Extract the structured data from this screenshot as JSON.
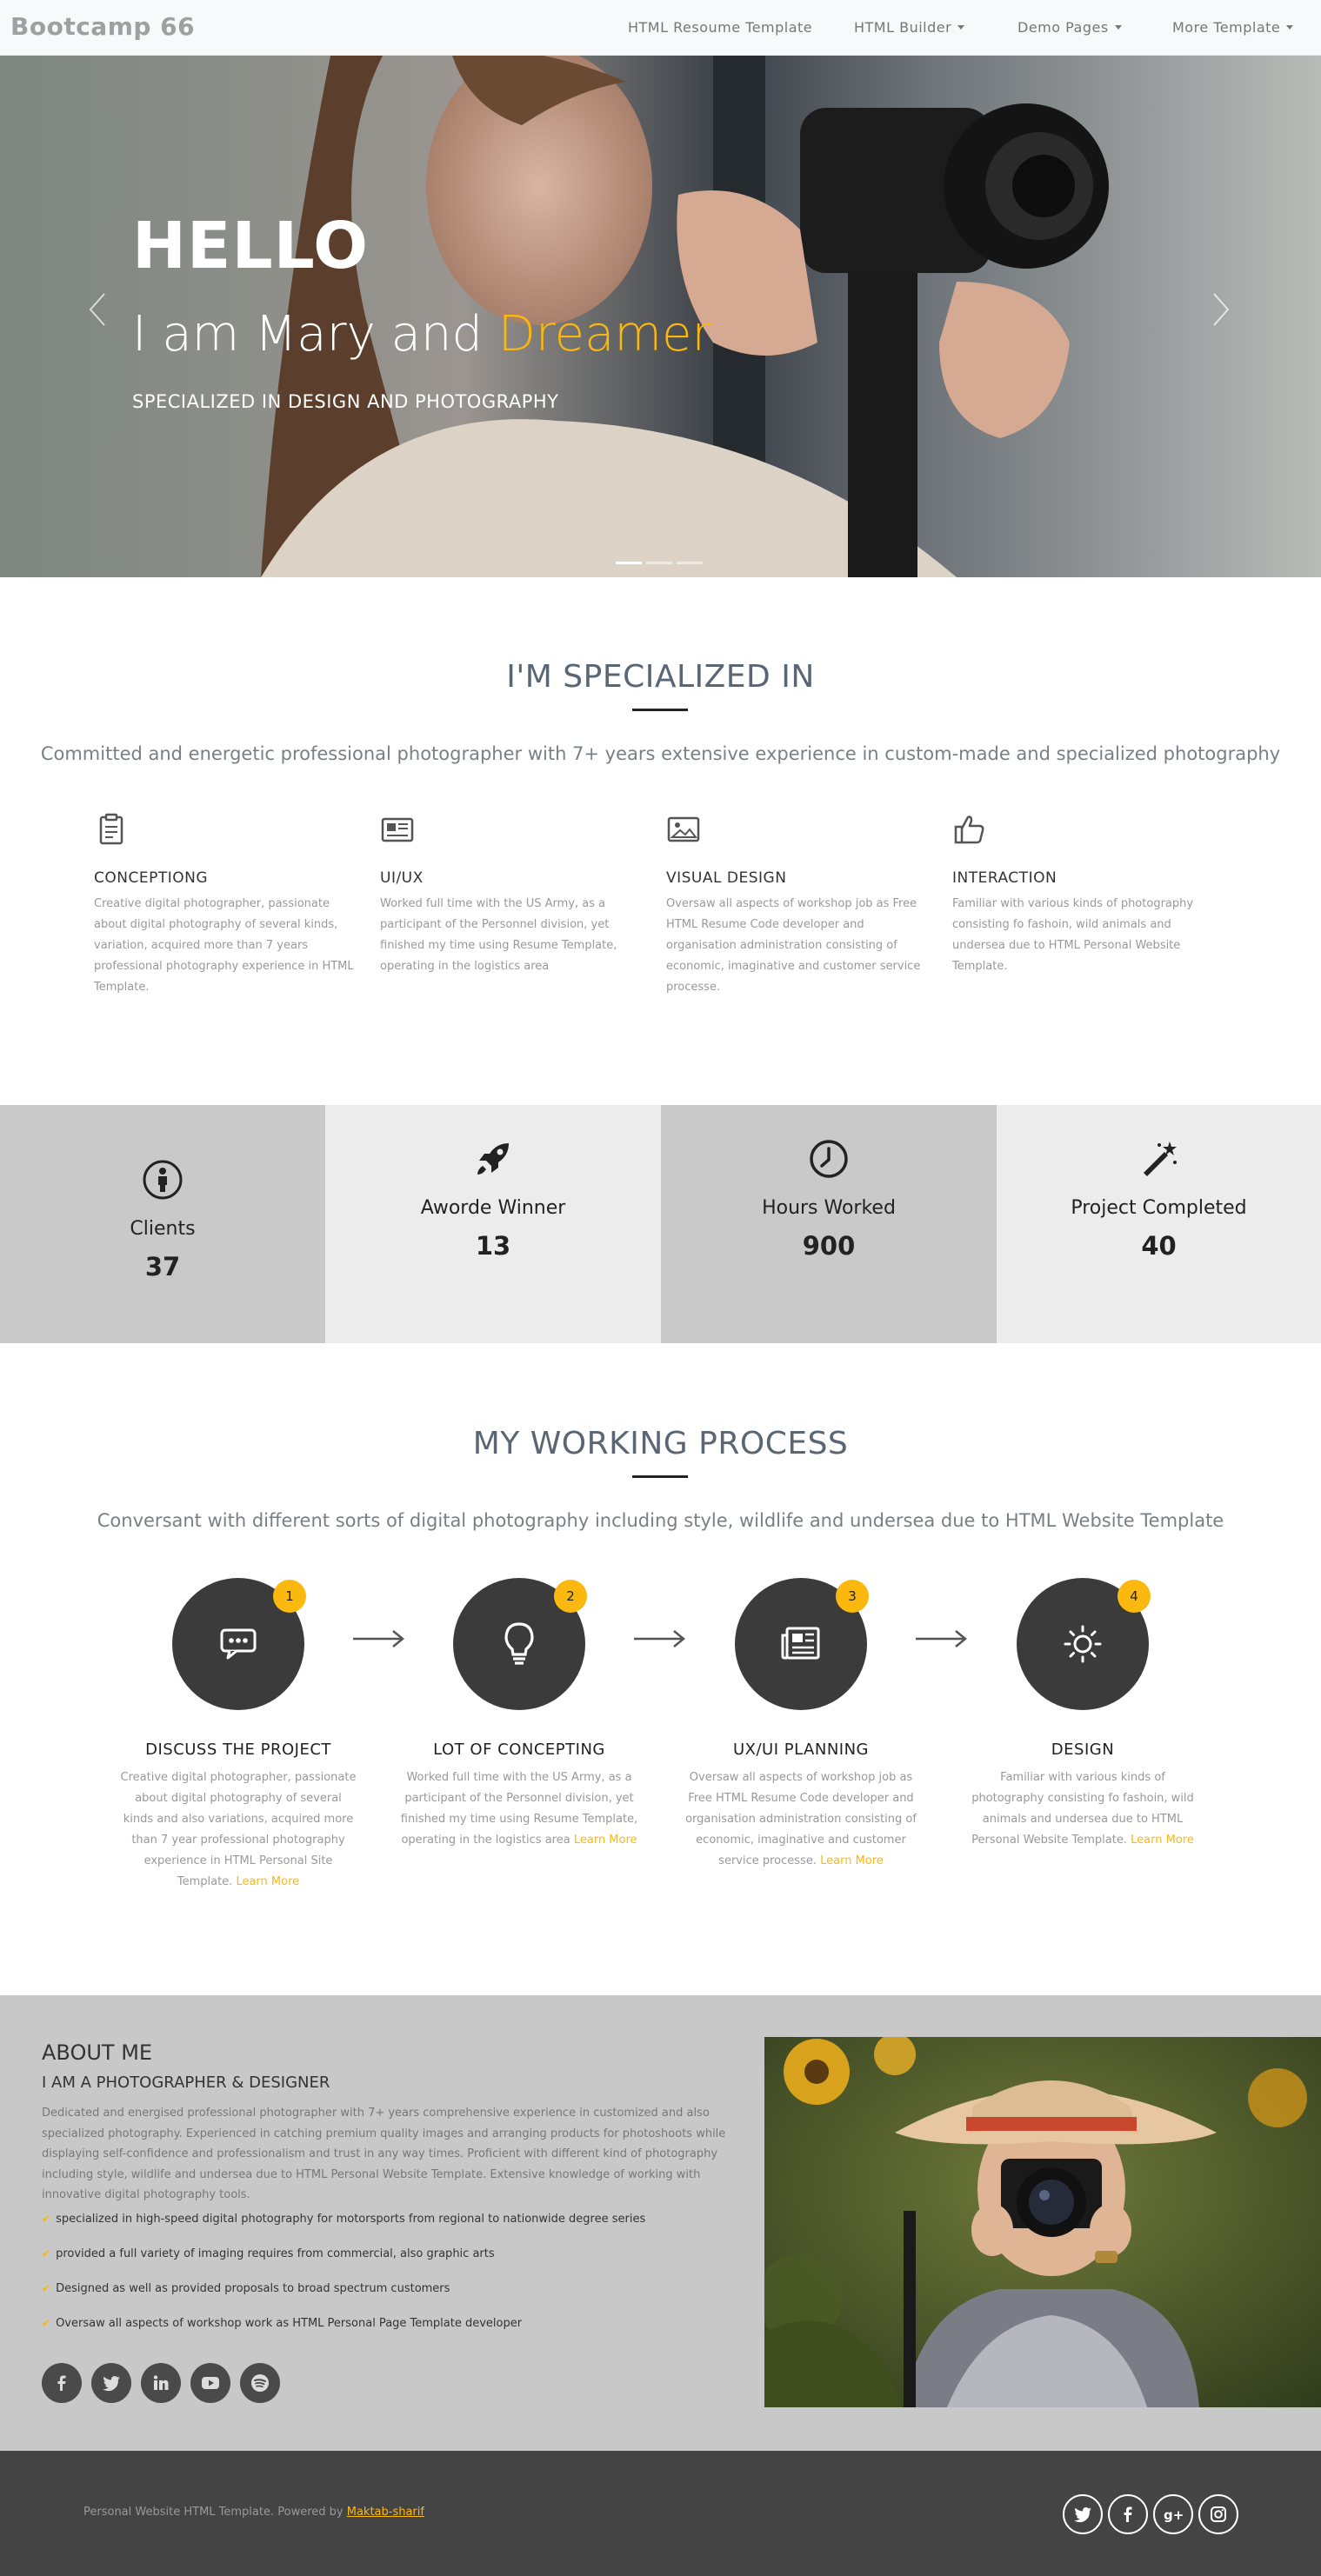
{
  "nav": {
    "brand": "Bootcamp 66",
    "items": [
      {
        "label": "HTML Resoume Template",
        "dropdown": false
      },
      {
        "label": "HTML Builder",
        "dropdown": true
      },
      {
        "label": "Demo Pages",
        "dropdown": true
      },
      {
        "label": "More Template",
        "dropdown": true
      }
    ]
  },
  "hero": {
    "hello": "HELLO",
    "line_prefix": "I am Mary and",
    "line_accent": "Dreamer",
    "subtitle": "SPECIALIZED IN DESIGN AND PHOTOGRAPHY",
    "prev_icon": "chevron-left-icon",
    "next_icon": "chevron-right-icon",
    "slides": 3,
    "active_slide": 1
  },
  "specialized": {
    "title": "I'M SPECIALIZED IN",
    "lead": "Committed and energetic professional photographer with 7+ years extensive experience in custom-made and specialized photography",
    "items": [
      {
        "icon": "clipboard-icon",
        "title": "CONCEPTIONG",
        "text": "Creative digital photographer, passionate about digital photography of several kinds, variation, acquired more than 7 years professional photography experience in HTML Template."
      },
      {
        "icon": "newspaper-icon",
        "title": "UI/UX",
        "text": "Worked full time with the US Army, as a participant of the Personnel division, yet finished my time using Resume Template, operating in the logistics area"
      },
      {
        "icon": "image-icon",
        "title": "VISUAL DESIGN",
        "text": "Oversaw all aspects of workshop job as Free HTML Resume Code developer and organisation administration consisting of economic, imaginative and customer service processe."
      },
      {
        "icon": "thumbs-up-icon",
        "title": "INTERACTION",
        "text": "Familiar with various kinds of photography consisting fo fashoin, wild animals and undersea due to HTML Personal Website Template."
      }
    ]
  },
  "stats": [
    {
      "icon": "person-icon",
      "label": "Clients",
      "value": "37",
      "bg": "#c9c9c9"
    },
    {
      "icon": "rocket-icon",
      "label": "Aworde Winner",
      "value": "13",
      "bg": "#ececec"
    },
    {
      "icon": "clock-icon",
      "label": "Hours Worked",
      "value": "900",
      "bg": "#c9c9c9"
    },
    {
      "icon": "magic-wand-icon",
      "label": "Project Completed",
      "value": "40",
      "bg": "#ececec"
    }
  ],
  "process": {
    "title": "MY WORKING PROCESS",
    "lead": "Conversant with different sorts of digital photography including style, wildlife and undersea due to HTML Website Template",
    "learn_more": "Learn More",
    "steps": [
      {
        "num": "1",
        "icon": "chat-bubble-icon",
        "title": "DISCUSS THE PROJECT",
        "text": "Creative digital photographer, passionate about digital photography of several kinds and also variations, acquired more than 7 year professional photography experience in HTML Personal Site Template."
      },
      {
        "num": "2",
        "icon": "lightbulb-icon",
        "title": "LOT OF CONCEPTING",
        "text": "Worked full time with the US Army, as a participant of the Personnel division, yet finished my time using Resume Template, operating in the logistics area"
      },
      {
        "num": "3",
        "icon": "newspaper-icon",
        "title": "UX/UI PLANNING",
        "text": "Oversaw all aspects of workshop job as Free HTML Resume Code developer and organisation administration consisting of economic, imaginative and customer service processe."
      },
      {
        "num": "4",
        "icon": "sun-icon",
        "title": "DESIGN",
        "text": "Familiar with various kinds of photography consisting fo fashoin, wild animals and undersea due to HTML Personal Website Template."
      }
    ]
  },
  "about": {
    "title": "ABOUT ME",
    "subtitle": "I AM A PHOTOGRAPHER & DESIGNER",
    "paragraph": "Dedicated and energised professional photographer with 7+ years comprehensive experience in customized and also specialized photography. Experienced in catching premium quality images and arranging products for photoshoots while displaying self-confidence and professionalism and trust in any way times. Proficient with different kind of photography including style, wildlife and undersea due to HTML Personal Website Template. Extensive knowledge of working with innovative digital photography tools.",
    "bullets": [
      "specialized in high-speed digital photography for motorsports from regional to nationwide degree series",
      "provided a full variety of imaging requires from commercial, also graphic arts",
      "Designed as well as provided proposals to broad spectrum customers",
      "Oversaw all aspects of workshop work as HTML Personal Page Template developer"
    ],
    "socials": [
      "facebook-icon",
      "twitter-icon",
      "linkedin-icon",
      "youtube-icon",
      "spotify-icon"
    ]
  },
  "footer": {
    "copy_prefix": "Personal Website HTML Template. Powered by",
    "copy_link": "Maktab-sharif",
    "socials": [
      "twitter-icon",
      "facebook-icon",
      "google-plus-icon",
      "instagram-icon"
    ]
  },
  "colors": {
    "accent": "#fbb80f",
    "dark": "#3b3b3b",
    "footer": "#444444"
  }
}
